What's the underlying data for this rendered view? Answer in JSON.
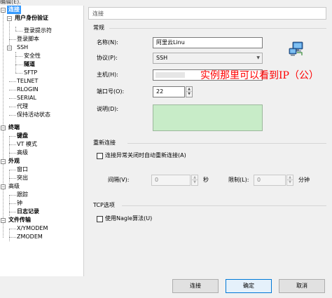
{
  "topbar": {
    "label": "编辑(E)."
  },
  "tree": {
    "items": [
      {
        "label": "连接"
      },
      {
        "label": "用户身份验证"
      },
      {
        "label": "登录提示符"
      },
      {
        "label": "登录脚本"
      },
      {
        "label": "SSH"
      },
      {
        "label": "安全性"
      },
      {
        "label": "隧道"
      },
      {
        "label": "SFTP"
      },
      {
        "label": "TELNET"
      },
      {
        "label": "RLOGIN"
      },
      {
        "label": "SERIAL"
      },
      {
        "label": "代理"
      },
      {
        "label": "保持活动状态"
      },
      {
        "label": "终端"
      },
      {
        "label": "键盘"
      },
      {
        "label": "VT 模式"
      },
      {
        "label": "高级"
      },
      {
        "label": "外观"
      },
      {
        "label": "窗口"
      },
      {
        "label": "突出"
      },
      {
        "label": "高级"
      },
      {
        "label": "跟踪"
      },
      {
        "label": "钟"
      },
      {
        "label": "日志记录"
      },
      {
        "label": "文件传输"
      },
      {
        "label": "X/YMODEM"
      },
      {
        "label": "ZMODEM"
      }
    ]
  },
  "panel": {
    "title": "连接",
    "general": {
      "section": "常规",
      "name_label": "名称(N):",
      "name_value": "阿里云Linu",
      "protocol_label": "协议(P):",
      "protocol_value": "SSH",
      "host_label": "主机(H):",
      "port_label": "端口号(O):",
      "port_value": "22",
      "desc_label": "说明(D):"
    },
    "reconnect": {
      "section": "重新连接",
      "checkbox_label": "连接异常关闭时自动重新连接(A)",
      "interval_label": "间隔(V):",
      "interval_value": "0",
      "interval_unit": "秒",
      "limit_label": "限制(L):",
      "limit_value": "0",
      "limit_unit": "分钟"
    },
    "tcp": {
      "section": "TCP选项",
      "nagle_label": "使用Nagle算法(U)"
    }
  },
  "annotation": "实例那里可以看到IP（公）",
  "buttons": {
    "connect": "连接",
    "ok": "确定",
    "cancel": "取消"
  }
}
